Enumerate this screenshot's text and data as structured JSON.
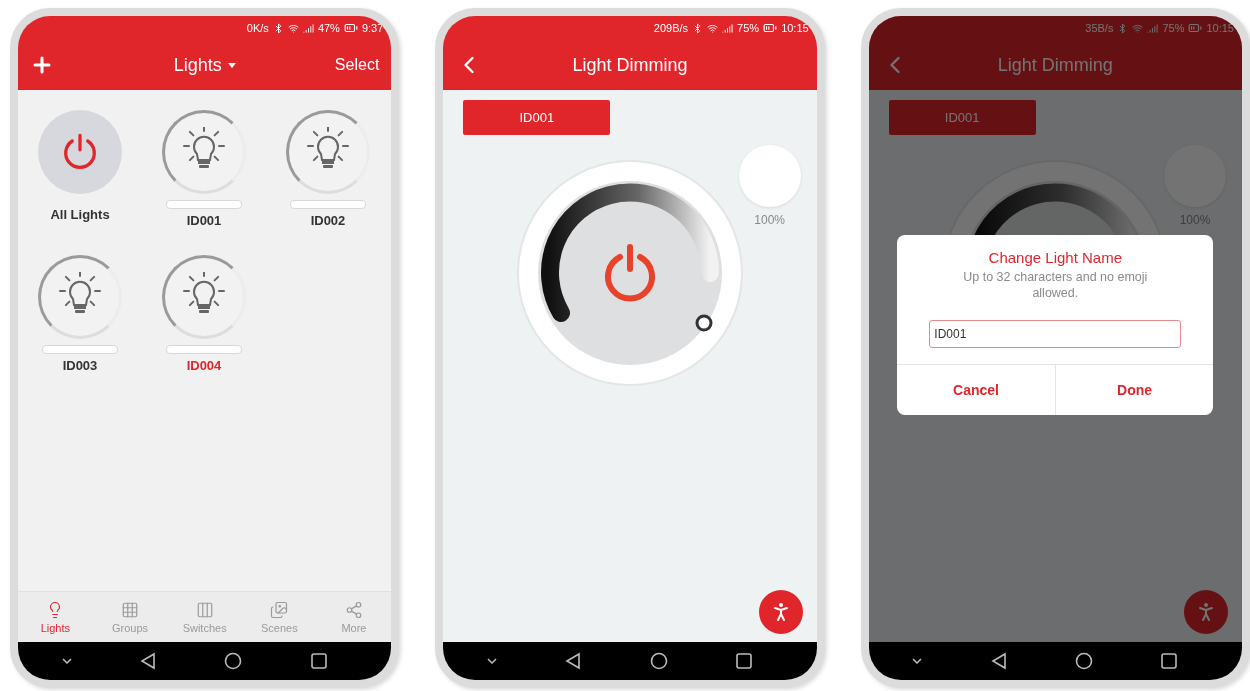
{
  "screens": [
    {
      "kind": "lights",
      "status_bar": {
        "speed": "0K/s",
        "battery": "47%",
        "time": "9:37"
      },
      "header": {
        "title": "Lights",
        "action": "Select"
      },
      "tiles": [
        {
          "kind": "all",
          "label": "All Lights",
          "selected": false
        },
        {
          "kind": "light",
          "label": "ID001",
          "selected": false
        },
        {
          "kind": "light",
          "label": "ID002",
          "selected": false
        },
        {
          "kind": "light",
          "label": "ID003",
          "selected": false
        },
        {
          "kind": "light",
          "label": "ID004",
          "selected": true
        }
      ],
      "nav": [
        {
          "kind": "lights",
          "label": "Lights",
          "selected": true
        },
        {
          "kind": "groups",
          "label": "Groups",
          "selected": false
        },
        {
          "kind": "switches",
          "label": "Switches",
          "selected": false
        },
        {
          "kind": "scenes",
          "label": "Scenes",
          "selected": false
        },
        {
          "kind": "more",
          "label": "More",
          "selected": false
        }
      ]
    },
    {
      "kind": "dimming",
      "status_bar": {
        "speed": "209B/s",
        "battery": "75%",
        "time": "10:15"
      },
      "header": {
        "title": "Light Dimming"
      },
      "light_name": "ID001",
      "brightness": "100%"
    },
    {
      "kind": "dimming",
      "status_bar": {
        "speed": "35B/s",
        "battery": "75%",
        "time": "10:15"
      },
      "header": {
        "title": "Light Dimming"
      },
      "light_name": "ID001",
      "brightness": "100%",
      "dialog": {
        "title": "Change Light Name",
        "message": "Up to 32 characters and no emoji allowed.",
        "value": "ID001",
        "buttons": [
          "Cancel",
          "Done"
        ]
      }
    }
  ]
}
